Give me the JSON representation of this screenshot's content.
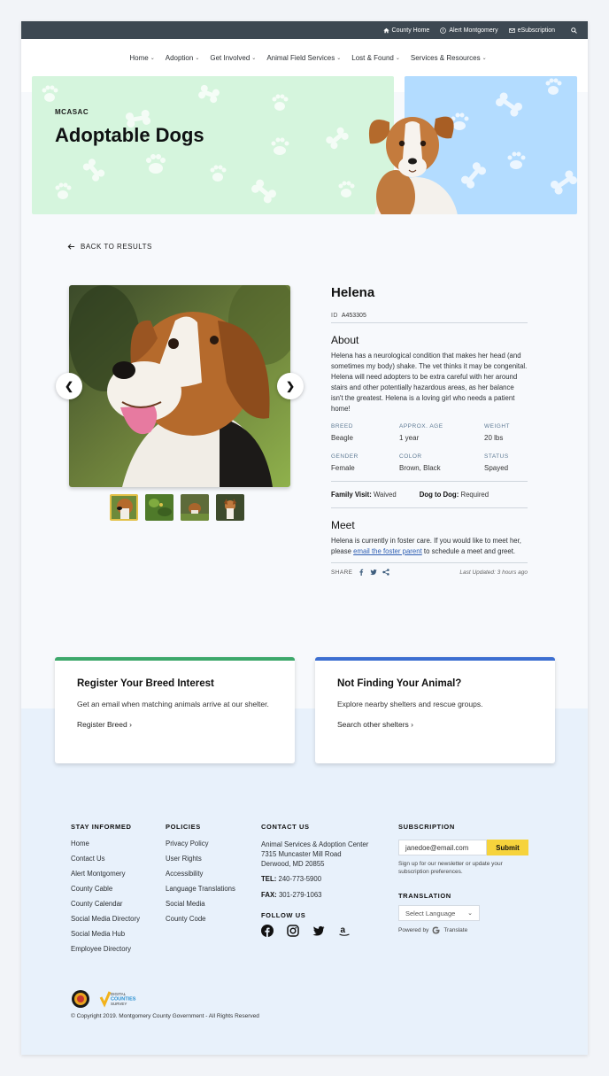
{
  "utility_bar": {
    "links": [
      {
        "label": "County Home",
        "icon": "home-icon"
      },
      {
        "label": "Alert Montgomery",
        "icon": "alert-icon"
      },
      {
        "label": "eSubscription",
        "icon": "mail-icon"
      }
    ],
    "search_icon": "search-icon"
  },
  "nav": {
    "items": [
      "Home",
      "Adoption",
      "Get Involved",
      "Animal Field Services",
      "Lost & Found",
      "Services & Resources"
    ]
  },
  "hero": {
    "kicker": "MCASAC",
    "title": "Adoptable Dogs",
    "colors": {
      "green": "#d5f5dd",
      "blue": "#b3dcff"
    }
  },
  "back_link": "BACK TO RESULTS",
  "animal": {
    "name": "Helena",
    "id_label": "ID",
    "id": "A453305",
    "about_heading": "About",
    "about": "Helena has a neurological condition that makes her head (and sometimes my body) shake. The vet thinks it may be congenital. Helena will need adopters to be extra careful with her around stairs and other potentially hazardous areas, as her balance isn't the greatest. Helena is  a loving girl who needs a patient home!",
    "facts": [
      {
        "label": "BREED",
        "value": "Beagle"
      },
      {
        "label": "APPROX. AGE",
        "value": "1 year"
      },
      {
        "label": "WEIGHT",
        "value": "20 lbs"
      },
      {
        "label": "GENDER",
        "value": "Female"
      },
      {
        "label": "COLOR",
        "value": "Brown, Black"
      },
      {
        "label": "STATUS",
        "value": "Spayed"
      }
    ],
    "family_visit_label": "Family Visit:",
    "family_visit": "Waived",
    "dog_to_dog_label": "Dog to Dog:",
    "dog_to_dog": "Required",
    "meet_heading": "Meet",
    "meet_before": "Helena is currently in foster care. If you would like to meet her, please ",
    "meet_link": "email the foster parent",
    "meet_after": " to schedule a meet and greet.",
    "share_label": "SHARE",
    "share_icons": [
      "facebook-icon",
      "twitter-icon",
      "share-icon"
    ],
    "last_updated": "Last Updated: 3 hours ago",
    "thumbnail_count": 4
  },
  "cards": [
    {
      "title": "Register Your Breed Interest",
      "text": "Get an email when matching animals arrive at our shelter.",
      "link": "Register Breed",
      "accent": "#3da86b"
    },
    {
      "title": "Not Finding Your Animal?",
      "text": "Explore nearby shelters and rescue groups.",
      "link": "Search other shelters",
      "accent": "#3d6fd1"
    }
  ],
  "footer": {
    "stay_informed": {
      "heading": "STAY INFORMED",
      "links": [
        "Home",
        "Contact Us",
        "Alert Montgomery",
        "County Cable",
        "County Calendar",
        "Social Media Directory",
        "Social Media Hub",
        "Employee Directory"
      ]
    },
    "policies": {
      "heading": "POLICIES",
      "links": [
        "Privacy Policy",
        "User Rights",
        "Accessibility",
        "Language Translations",
        "Social Media",
        "County Code"
      ]
    },
    "contact": {
      "heading": "CONTACT US",
      "address_lines": [
        "Animal Services & Adoption Center",
        "7315 Muncaster Mill Road",
        "Derwood, MD 20855"
      ],
      "tel_label": "TEL:",
      "tel": "240-773-5900",
      "fax_label": "FAX:",
      "fax": "301-279-1063",
      "follow_heading": "FOLLOW US",
      "social_icons": [
        "facebook-icon",
        "instagram-icon",
        "twitter-icon",
        "amazon-icon"
      ]
    },
    "subscription": {
      "heading": "SUBSCRIPTION",
      "email_value": "janedoe@email.com",
      "submit_label": "Submit",
      "note": "Sign up for our newsletter or update your subscription preferences."
    },
    "translation": {
      "heading": "TRANSLATION",
      "select_value": "Select Language",
      "powered_by": "Powered by",
      "translate_label": "Translate"
    },
    "badge_text": [
      "DIGITAL",
      "COUNTIES",
      "SURVEY"
    ],
    "copyright": "© Copyright 2019. Montgomery County Government - All Rights Reserved"
  }
}
